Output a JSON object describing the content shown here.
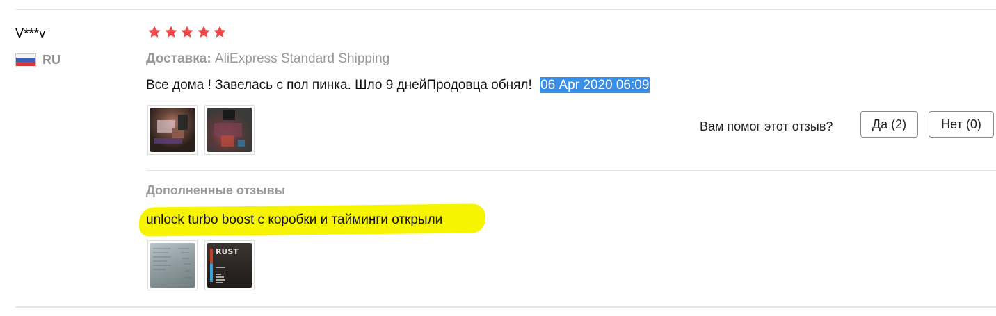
{
  "user": {
    "name": "V***v",
    "country_code": "RU",
    "flag_icon": "russia-flag-icon"
  },
  "rating": {
    "stars": 5,
    "max": 5,
    "color": "#f04848"
  },
  "delivery": {
    "label": "Доставка:",
    "value": "AliExpress Standard Shipping"
  },
  "review": {
    "text": "Все дома ! Завелась с пол пинка. Шло 9 днейПродовца обнял!",
    "date": "06 Apr 2020 06:09",
    "date_highlight_color": "#3a8ee6",
    "photos": [
      "review-photo-1",
      "review-photo-2"
    ]
  },
  "helpful": {
    "question": "Вам помог этот отзыв?",
    "yes_label": "Да (2)",
    "no_label": "Нет (0)"
  },
  "followup": {
    "title": "Дополненные отзывы",
    "text": "unlock turbo boost с коробки и тайминги открыли",
    "highlight_color": "#f7f400",
    "photos": [
      "followup-photo-1",
      "followup-photo-2"
    ]
  }
}
